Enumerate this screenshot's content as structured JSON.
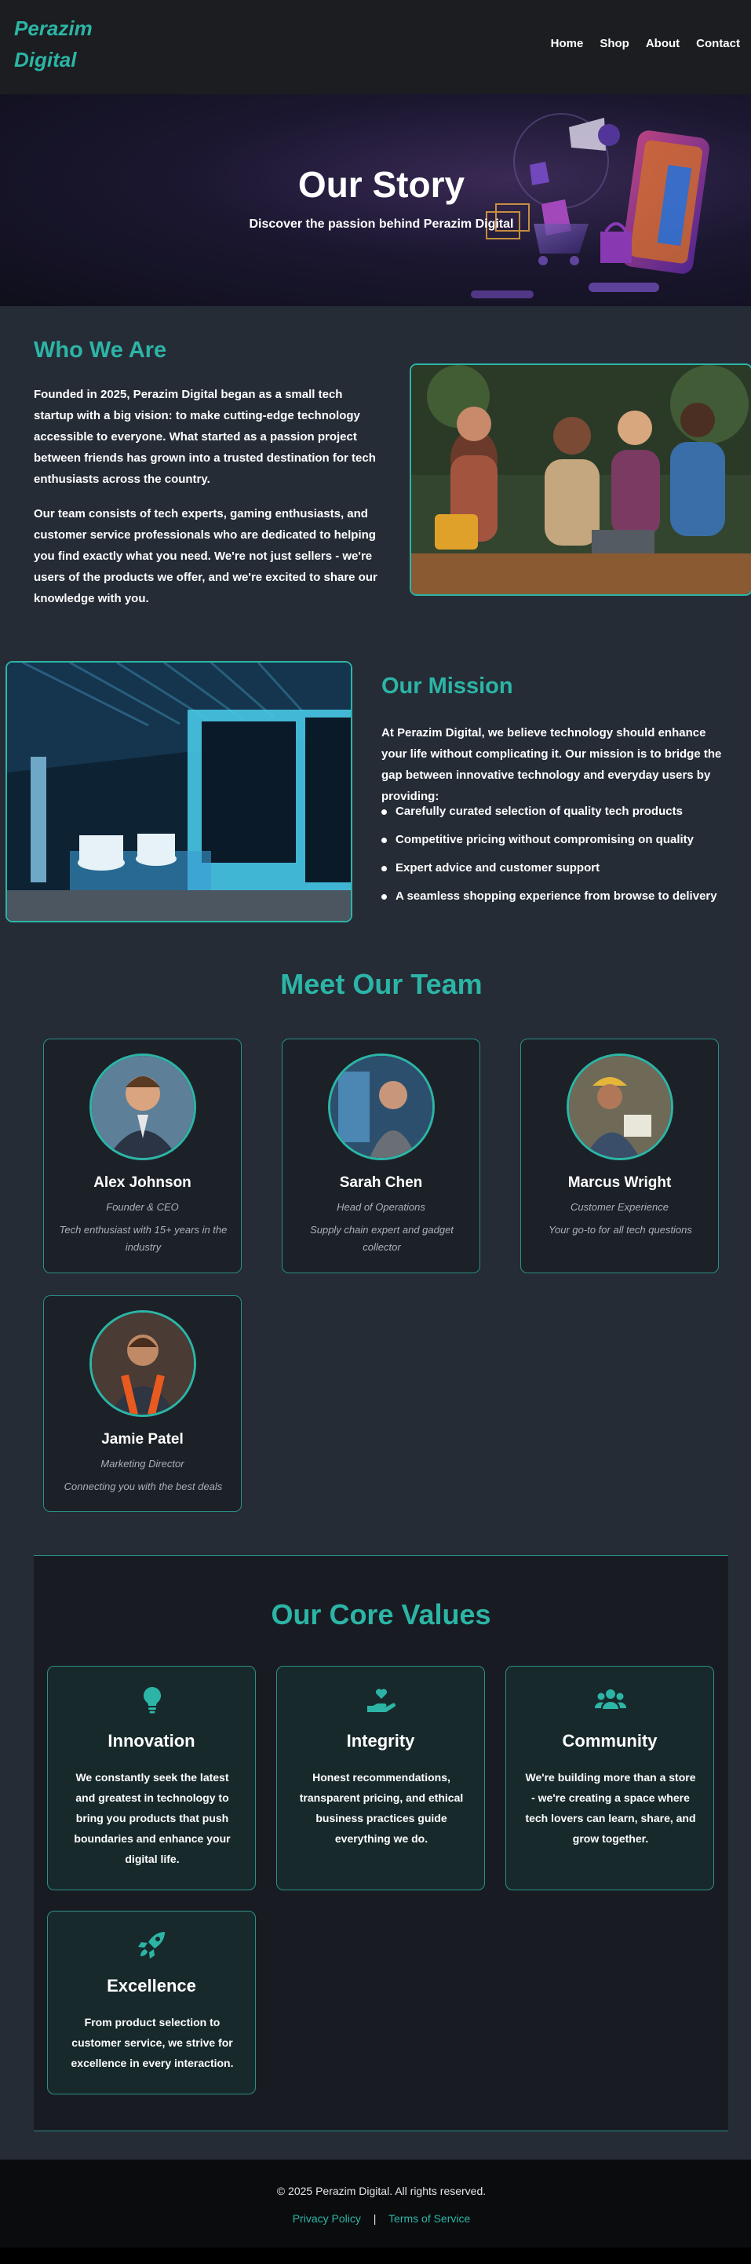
{
  "nav": {
    "brand": "Perazim Digital",
    "links": [
      "Home",
      "Shop",
      "About",
      "Contact"
    ]
  },
  "hero": {
    "title": "Our Story",
    "subtitle": "Discover the passion behind Perazim Digital"
  },
  "who": {
    "title": "Who We Are",
    "p1": "Founded in 2025, Perazim Digital began as a small tech startup with a big vision: to make cutting-edge technology accessible to everyone. What started as a passion project between friends has grown into a trusted destination for tech enthusiasts across the country.",
    "p2": "Our team consists of tech experts, gaming enthusiasts, and customer service professionals who are dedicated to helping you find exactly what you need. We're not just sellers - we're users of the products we offer, and we're excited to share our knowledge with you."
  },
  "mission": {
    "title": "Our Mission",
    "text": "At Perazim Digital, we believe technology should enhance your life without complicating it. Our mission is to bridge the gap between innovative technology and everyday users by providing:",
    "items": [
      "Carefully curated selection of quality tech products",
      "Competitive pricing without compromising on quality",
      "Expert advice and customer support",
      "A seamless shopping experience from browse to delivery"
    ]
  },
  "team": {
    "title": "Meet Our Team",
    "members": [
      {
        "name": "Alex Johnson",
        "role": "Founder & CEO",
        "bio": "Tech enthusiast with 15+ years in the industry"
      },
      {
        "name": "Sarah Chen",
        "role": "Head of Operations",
        "bio": "Supply chain expert and gadget collector"
      },
      {
        "name": "Marcus Wright",
        "role": "Customer Experience",
        "bio": "Your go-to for all tech questions"
      },
      {
        "name": "Jamie Patel",
        "role": "Marketing Director",
        "bio": "Connecting you with the best deals"
      }
    ]
  },
  "values": {
    "title": "Our Core Values",
    "items": [
      {
        "icon": "lightbulb-icon",
        "name": "Innovation",
        "text": "We constantly seek the latest and greatest in technology to bring you products that push boundaries and enhance your digital life."
      },
      {
        "icon": "hand-heart-icon",
        "name": "Integrity",
        "text": "Honest recommendations, transparent pricing, and ethical business practices guide everything we do."
      },
      {
        "icon": "users-icon",
        "name": "Community",
        "text": "We're building more than a store - we're creating a space where tech lovers can learn, share, and grow together."
      },
      {
        "icon": "rocket-icon",
        "name": "Excellence",
        "text": "From product selection to customer service, we strive for excellence in every interaction."
      }
    ]
  },
  "footer": {
    "copyright": "© 2025 Perazim Digital. All rights reserved.",
    "privacy": "Privacy Policy",
    "separator": "|",
    "terms": "Terms of Service"
  },
  "colors": {
    "accent": "#2cb5a6",
    "background": "#252c36",
    "nav": "#1b1d20",
    "card": "#1c2027"
  }
}
